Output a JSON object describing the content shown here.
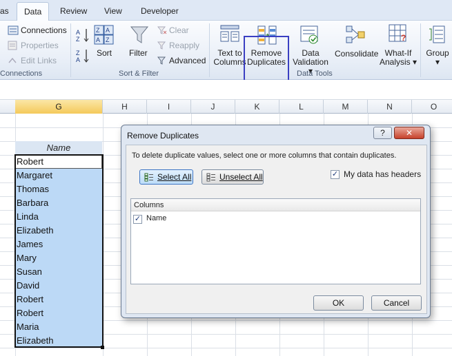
{
  "ribbon": {
    "tabs": [
      {
        "label": "as"
      },
      {
        "label": "Data"
      },
      {
        "label": "Review"
      },
      {
        "label": "View"
      },
      {
        "label": "Developer"
      }
    ],
    "connections": {
      "connections": "Connections",
      "properties": "Properties",
      "edit_links": "Edit Links",
      "group": "Connections"
    },
    "sort_filter": {
      "sort": "Sort",
      "filter": "Filter",
      "clear": "Clear",
      "reapply": "Reapply",
      "advanced": "Advanced",
      "group": "Sort & Filter"
    },
    "data_tools": {
      "text_to_columns": [
        "Text to",
        "Columns"
      ],
      "remove_duplicates": [
        "Remove",
        "Duplicates"
      ],
      "data_validation": [
        "Data",
        "Validation"
      ],
      "consolidate": "Consolidate",
      "what_if": [
        "What-If",
        "Analysis"
      ],
      "group": "Data Tools"
    },
    "outline": {
      "group_btn": "Group"
    }
  },
  "sheet": {
    "columns": [
      "G",
      "H",
      "I",
      "J",
      "K",
      "L",
      "M",
      "N",
      "O"
    ],
    "header": "Name",
    "names": [
      "Robert",
      "Margaret",
      "Thomas",
      "Barbara",
      "Linda",
      "Elizabeth",
      "James",
      "Mary",
      "Susan",
      "David",
      "Robert",
      "Robert",
      "Maria",
      "Elizabeth"
    ]
  },
  "dialog": {
    "title": "Remove Duplicates",
    "help": "?",
    "close": "✕",
    "instruction": "To delete duplicate values, select one or more columns that contain duplicates.",
    "select_all": "Select All",
    "unselect_all": "Unselect All",
    "headers_label": "My data has headers",
    "headers_checked": true,
    "columns_header": "Columns",
    "columns": [
      {
        "name": "Name",
        "checked": true
      }
    ],
    "ok": "OK",
    "cancel": "Cancel"
  }
}
